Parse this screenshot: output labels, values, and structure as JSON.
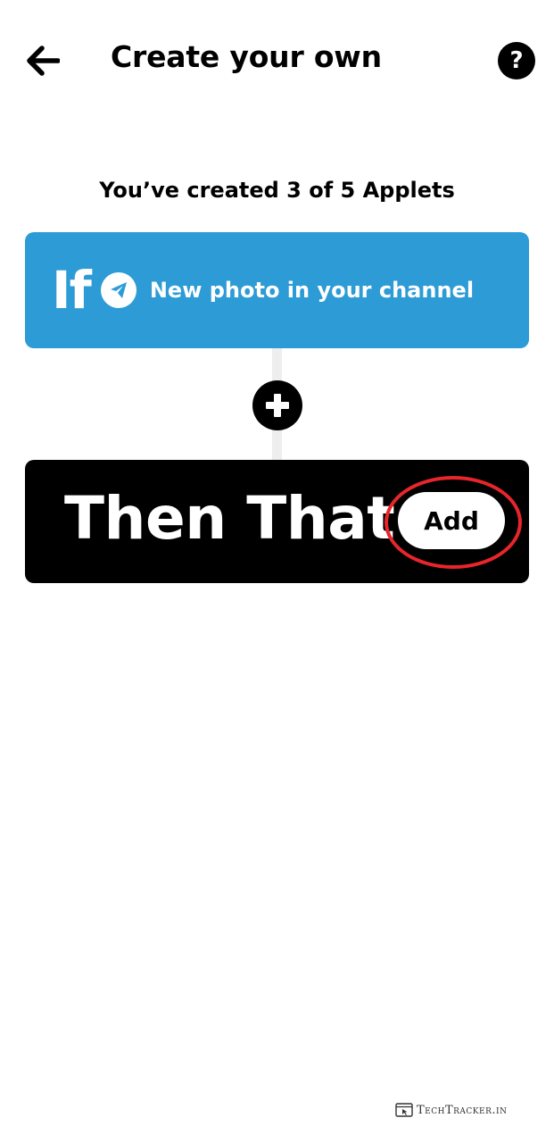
{
  "header": {
    "title": "Create your own",
    "back_icon": "arrow-left-icon",
    "help_label": "?"
  },
  "status": {
    "applet_count_text": "You’ve created 3 of 5 Applets"
  },
  "trigger": {
    "if_word": "If",
    "service_icon": "telegram-icon",
    "label": "New photo in your channel",
    "color": "#2c9bd6"
  },
  "connector": {
    "plus_icon": "plus-icon"
  },
  "action": {
    "then_word": "Then That",
    "add_label": "Add",
    "highlight_color": "#e8252b"
  },
  "watermark": {
    "text": "TechTracker.in"
  }
}
